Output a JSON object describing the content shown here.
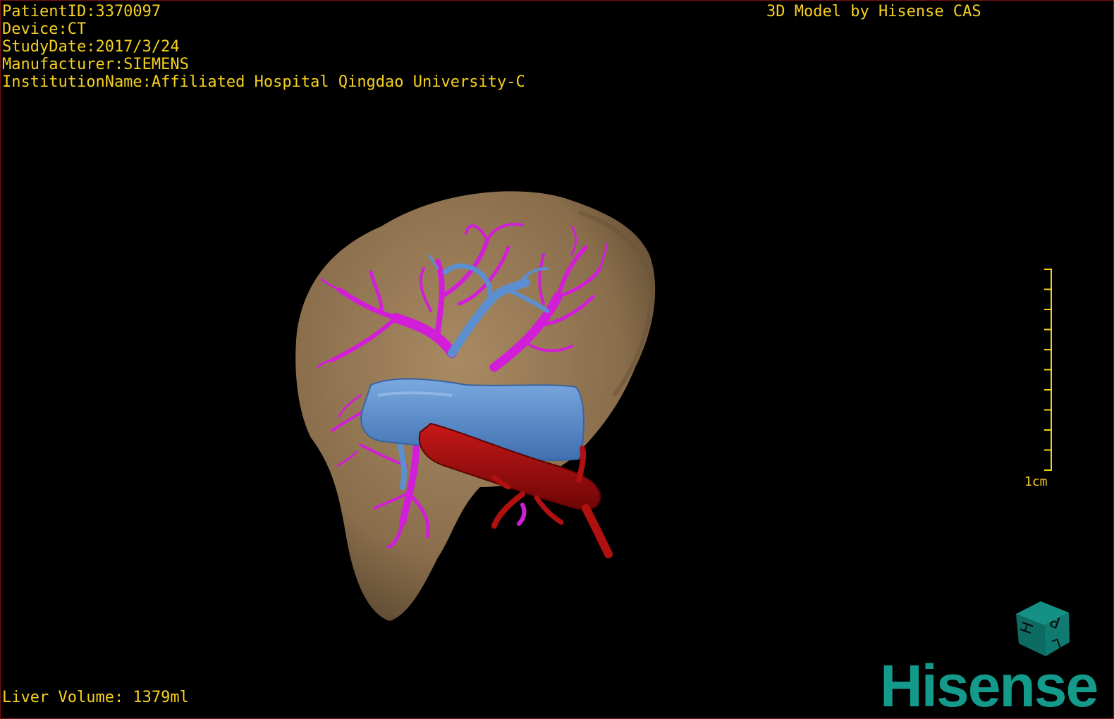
{
  "header": {
    "patient_id": "PatientID:3370097",
    "device": "Device:CT",
    "study_date": "StudyDate:2017/3/24",
    "manufacturer": "Manufacturer:SIEMENS",
    "institution": "InstitutionName:Affiliated Hospital Qingdao University-C"
  },
  "credit": "3D Model by Hisense CAS",
  "footer": {
    "liver_volume": "Liver Volume: 1379ml"
  },
  "scale": {
    "label": "1cm",
    "tick_count": 10
  },
  "orientation_cube": {
    "faces": [
      "H",
      "P",
      "L"
    ],
    "color": "#0f6b63"
  },
  "brand": {
    "name": "Hisense",
    "color": "#139a8a"
  },
  "colors": {
    "text": "#f5d020",
    "liver": "#8e7350",
    "hepatic_vein": "#d21ed8",
    "portal_vein": "#5b8fd0",
    "ivc": "#b01010"
  }
}
